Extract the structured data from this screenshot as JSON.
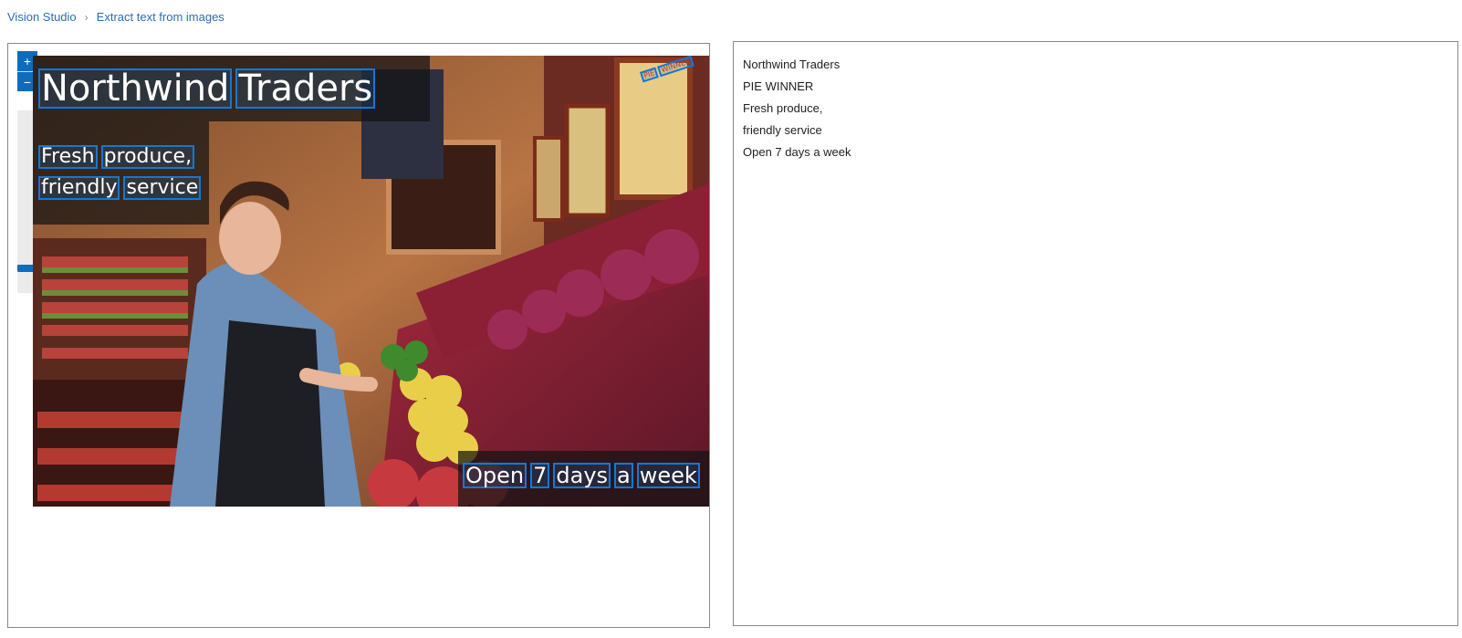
{
  "breadcrumb": {
    "items": [
      "Vision Studio",
      "Extract text from images"
    ]
  },
  "zoom": {
    "in_label": "+",
    "out_label": "−",
    "level_fraction": 0.12
  },
  "image_overlay": {
    "title_words": [
      "Northwind",
      "Traders"
    ],
    "line2_words": [
      "Fresh",
      "produce,"
    ],
    "line3_words": [
      "friendly",
      "service"
    ],
    "bottom_words": [
      "Open",
      "7",
      "days",
      "a",
      "week"
    ],
    "sign_words": [
      "PIE",
      "WINNER"
    ]
  },
  "extracted_text": {
    "lines": [
      "Northwind Traders",
      "PIE WINNER",
      "Fresh produce,",
      "friendly service",
      "Open 7 days a week"
    ]
  },
  "colors": {
    "accent": "#0f6cbd",
    "link": "#2b6cb3",
    "bbox": "#1478d4"
  }
}
